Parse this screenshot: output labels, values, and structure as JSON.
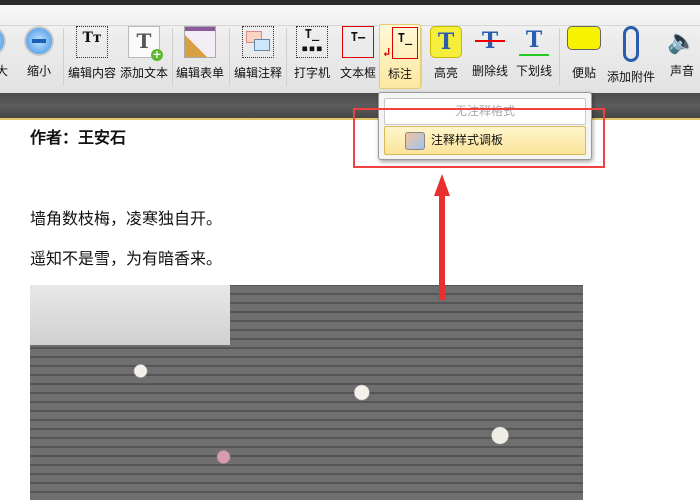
{
  "toolbar": {
    "buttons": [
      {
        "label": "大",
        "icon": "zoom-in-icon"
      },
      {
        "label": "缩小",
        "icon": "zoom-out-icon"
      },
      {
        "label": "编辑内容",
        "icon": "edit-content-icon"
      },
      {
        "label": "添加文本",
        "icon": "add-text-icon"
      },
      {
        "label": "编辑表单",
        "icon": "edit-form-icon"
      },
      {
        "label": "编辑注释",
        "icon": "edit-annotation-icon"
      },
      {
        "label": "打字机",
        "icon": "typewriter-icon"
      },
      {
        "label": "文本框",
        "icon": "textbox-icon"
      },
      {
        "label": "标注",
        "icon": "callout-icon"
      },
      {
        "label": "高亮",
        "icon": "highlight-icon"
      },
      {
        "label": "删除线",
        "icon": "strikethrough-icon"
      },
      {
        "label": "下划线",
        "icon": "underline-icon"
      },
      {
        "label": "便贴",
        "icon": "sticky-note-icon"
      },
      {
        "label": "添加附件",
        "icon": "attachment-icon"
      },
      {
        "label": "声音",
        "icon": "sound-icon"
      }
    ]
  },
  "dropdown": {
    "items": [
      {
        "label": "无注释格式",
        "disabled": true
      },
      {
        "label": "注释样式调板",
        "highlighted": true
      }
    ]
  },
  "document": {
    "author": "作者：王安石",
    "lines": [
      "墙角数枝梅，凌寒独自开。",
      "遥知不是雪，为有暗香来。"
    ]
  },
  "colors": {
    "highlight_box": "#f04040",
    "arrow": "#e83030"
  }
}
